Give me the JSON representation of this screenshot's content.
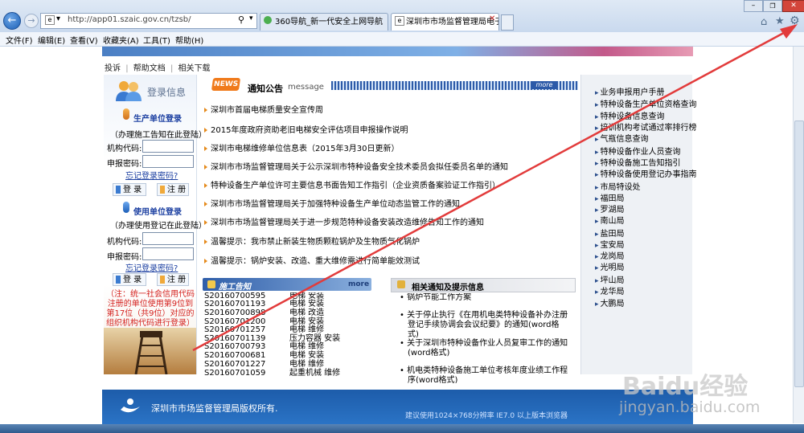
{
  "browser": {
    "url": "http://app01.szaic.gov.cn/tzsb/",
    "tabs": [
      "360导航_新一代安全上网导航",
      "深圳市市场监督管理局电子..."
    ],
    "menus": [
      "文件(F)",
      "编辑(E)",
      "查看(V)",
      "收藏夹(A)",
      "工具(T)",
      "帮助(H)"
    ]
  },
  "top_links": [
    "投诉",
    "帮助文档",
    "相关下载"
  ],
  "login": {
    "title": "登录信息",
    "production": {
      "title": "生产单位登录",
      "note": "（办理施工告知在此登陆）",
      "org_code_label": "机构代码:",
      "password_label": "申报密码:",
      "forgot": "忘记登录密码?",
      "login_btn": "登 录",
      "register_btn": "注 册"
    },
    "user": {
      "title": "使用单位登录",
      "note": "（办理使用登记在此登陆）",
      "org_code_label": "机构代码:",
      "password_label": "申报密码:",
      "forgot": "忘记登录密码?",
      "login_btn": "登 录",
      "register_btn": "注 册"
    },
    "warning": "（注：统一社会信用代码注册的单位使用第9位到第17位（共9位）对应的组织机构代码进行登录）"
  },
  "notice": {
    "badge": "NEWS",
    "title": "通知公告",
    "subtitle": "message",
    "more": "more",
    "items": [
      "深圳市首届电梯质量安全宣传周",
      "2015年度政府资助老旧电梯安全评估项目申报操作说明",
      "深圳市电梯维修单位信息表（2015年3月30日更新）",
      "深圳市市场监督管理局关于公示深圳市特种设备安全技术委员会拟任委员名单的通知",
      "特种设备生产单位许可主要信息书面告知工作指引（企业资质备案验证工作指引）",
      "深圳市市场监督管理局关于加强特种设备生产单位动态监管工作的通知",
      "深圳市市场监督管理局关于进一步规范特种设备安装改造维修告知工作的通知",
      "温馨提示：我市禁止新装生物质颗粒锅炉及生物质气化锅炉",
      "温馨提示：锅炉安装、改造、重大维修需进行简单能效测试"
    ]
  },
  "construction": {
    "title": "施工告知",
    "more": "more",
    "rows": [
      {
        "code": "S20160700595",
        "type": "电梯 安装"
      },
      {
        "code": "S20160701193",
        "type": "电梯 安装"
      },
      {
        "code": "S20160700898",
        "type": "电梯 改造"
      },
      {
        "code": "S20160701200",
        "type": "电梯 安装"
      },
      {
        "code": "S20160701257",
        "type": "电梯 维修"
      },
      {
        "code": "S20160701139",
        "type": "压力容器 安装"
      },
      {
        "code": "S20160700793",
        "type": "电梯 维修"
      },
      {
        "code": "S20160700681",
        "type": "电梯 安装"
      },
      {
        "code": "S20160701227",
        "type": "电梯 维修"
      },
      {
        "code": "S20160701059",
        "type": "起重机械 维修"
      }
    ]
  },
  "related": {
    "title": "相关通知及提示信息",
    "items": [
      "锅炉节能工作方案",
      "关于停止执行《在用机电类特种设备补办注册登记手续协调会会议纪要》的通知(word格式)",
      "关于深圳市特种设备作业人员复审工作的通知(word格式)",
      "机电类特种设备施工单位考核年度业绩工作程序(word格式)"
    ]
  },
  "right_links": [
    "业务申报用户手册",
    "特种设备生产单位资格查询",
    "特种设备信息查询",
    "培训机构考试通过率排行榜",
    "气瓶信息查询",
    "特种设备作业人员查询",
    "特种设备施工告知指引",
    "特种设备使用登记办事指南",
    "市局特设处",
    "福田局",
    "罗湖局",
    "南山局",
    "盐田局",
    "宝安局",
    "龙岗局",
    "光明局",
    "坪山局",
    "龙华局",
    "大鹏局"
  ],
  "footer": {
    "copyright": "深圳市市场监督管理局版权所有.",
    "recommend": "建议使用1024×768分辨率 IE7.0 以上版本浏览器"
  },
  "watermark": {
    "text": "Baidu经验",
    "url": "jingyan.baidu.com"
  },
  "colors": {
    "accent": "#2c5aa8",
    "arrow": "#e23b3b",
    "warning": "#d4211e"
  }
}
